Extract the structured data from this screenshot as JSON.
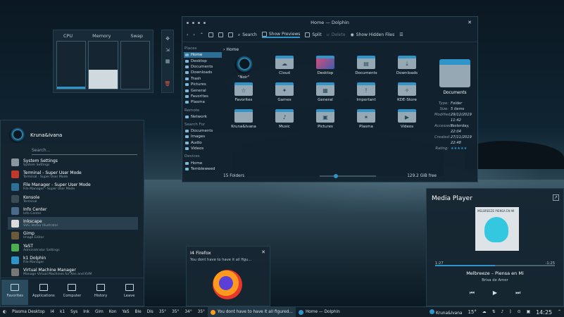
{
  "system_monitor": {
    "labels": [
      "CPU",
      "Memory",
      "Swap"
    ],
    "cpu_level": 0.04,
    "memory_level": 0.4,
    "swap_level": 0.0
  },
  "dolphin": {
    "title": "Home — Dolphin",
    "toolbar": {
      "search": "Search",
      "show_previews": "Show Previews",
      "split": "Split",
      "delete": "Delete",
      "show_hidden": "Show Hidden Files"
    },
    "places": {
      "places_header": "Places",
      "places": [
        "Home",
        "Desktop",
        "Documents",
        "Downloads",
        "Trash",
        "Pictures",
        "General",
        "Favorites",
        "Plasma"
      ],
      "remote_header": "Remote",
      "remote": [
        "Network"
      ],
      "search_header": "Search For",
      "search": [
        "Documents",
        "Images",
        "Audio",
        "Videos"
      ],
      "devices_header": "Devices",
      "devices": [
        "Home",
        "Tembleweed"
      ]
    },
    "breadcrumb": "Home",
    "files": [
      "\"Noir\"",
      "Cloud",
      "Desktop",
      "Documents",
      "Downloads",
      "Favorites",
      "Games",
      "General",
      "Important",
      "KDE-Store",
      "Kruna&Ivana",
      "Music",
      "Pictures",
      "Plasma",
      "Videos"
    ],
    "info": {
      "name": "Documents",
      "rows": [
        {
          "k": "Type:",
          "v": "Folder"
        },
        {
          "k": "Size:",
          "v": "5 items"
        },
        {
          "k": "Modified:",
          "v": "29/12/2019"
        },
        {
          "k": "",
          "v": "11:42"
        },
        {
          "k": "Accessed:",
          "v": "Yesterday,"
        },
        {
          "k": "",
          "v": "22:04"
        },
        {
          "k": "Created:",
          "v": "27/11/2019"
        },
        {
          "k": "",
          "v": "22:48"
        },
        {
          "k": "Rating:",
          "v": "★★★★★"
        }
      ]
    },
    "status_left": "15 Folders",
    "status_right": "129.2 GiB free"
  },
  "launcher": {
    "user": "Kruna&Ivana",
    "search_placeholder": "Search...",
    "items": [
      {
        "title": "System Settings",
        "sub": "System Settings"
      },
      {
        "title": "Terminal - Super User Mode",
        "sub": "Terminal - Super User Mode"
      },
      {
        "title": "File Manager - Super User Mode",
        "sub": "File Manager - Super User Mode"
      },
      {
        "title": "Konsole",
        "sub": "Terminal"
      },
      {
        "title": "Info Center",
        "sub": "Info Center"
      },
      {
        "title": "Inkscape",
        "sub": "SVG Vector Illustrator"
      },
      {
        "title": "Gimp",
        "sub": "Image Editor"
      },
      {
        "title": "YaST",
        "sub": "Administrator Settings"
      },
      {
        "title": "k1 Dolphin",
        "sub": "File Manager"
      },
      {
        "title": "Virtual Machine Manager",
        "sub": "Manage Virtual Machines for Xen and KVM"
      }
    ],
    "tabs": [
      "Favorites",
      "Applications",
      "Computer",
      "History",
      "Leave"
    ]
  },
  "notification": {
    "title": "I4 Firefox",
    "body": "You dont have to have it all figu..."
  },
  "media": {
    "title": "Media Player",
    "cover_text": "MELBREEZE PIENSA EN MI",
    "time_elapsed": "1:27",
    "time_remaining": "-1:25",
    "song": "Melbreeze – Piensa en Mi",
    "artist": "Brisa de Amor",
    "progress": 0.5
  },
  "taskbar": {
    "activity": "Plasma Desktop",
    "short": [
      "I4",
      "k1"
    ],
    "widgets": [
      "Sys",
      "Ink",
      "Gim",
      "Kon",
      "YaS",
      "Ble",
      "Dis"
    ],
    "temps": [
      "35°",
      "35°",
      "34°",
      "35°"
    ],
    "task1": "You dont have to have it all figured...",
    "task2": "Home — Dolphin",
    "user": "Kruna&Ivana",
    "weather": "15°",
    "clock": "14:25"
  },
  "colors": {
    "accent": "#2f95c9",
    "panel": "#14242f"
  }
}
